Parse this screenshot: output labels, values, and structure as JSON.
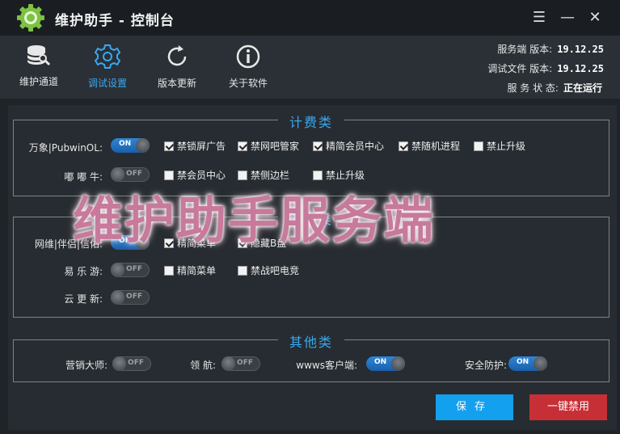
{
  "title": "维护助手 - 控制台",
  "window_controls": {
    "menu": "☰",
    "minimize": "—",
    "close": "✕"
  },
  "toolbar": {
    "items": [
      {
        "label": "维护通道",
        "icon": "database-wrench-icon"
      },
      {
        "label": "调试设置",
        "icon": "gear-icon",
        "active": true
      },
      {
        "label": "版本更新",
        "icon": "refresh-icon"
      },
      {
        "label": "关于软件",
        "icon": "info-icon"
      }
    ]
  },
  "info": {
    "server_version_label": "服务端 版本:",
    "server_version": "19.12.25",
    "debug_version_label": "调试文件 版本:",
    "debug_version": "19.12.25",
    "status_label": "服 务 状 态:",
    "status": "正在运行"
  },
  "groups": {
    "billing": {
      "title": "计费类",
      "rows": [
        {
          "label": "万象|PubwinOL:",
          "toggle": "ON",
          "options": [
            {
              "label": "禁锁屏广告",
              "checked": true
            },
            {
              "label": "禁网吧管家",
              "checked": true
            },
            {
              "label": "精简会员中心",
              "checked": true
            },
            {
              "label": "禁随机进程",
              "checked": true
            },
            {
              "label": "禁止升级",
              "checked": false
            }
          ]
        },
        {
          "label": "嘟 嘟 牛:",
          "toggle": "OFF",
          "options": [
            {
              "label": "禁会员中心",
              "checked": false
            },
            {
              "label": "禁侧边栏",
              "checked": false
            },
            {
              "label": "禁止升级",
              "checked": false
            }
          ]
        }
      ]
    },
    "diskless": {
      "title": "无盘类",
      "rows": [
        {
          "label": "网维|伴侣|信佑:",
          "toggle": "ON",
          "options": [
            {
              "label": "精简菜单",
              "checked": true
            },
            {
              "label": "隐藏B盘",
              "checked": true
            }
          ]
        },
        {
          "label": "易 乐 游:",
          "toggle": "OFF",
          "options": [
            {
              "label": "精简菜单",
              "checked": false
            },
            {
              "label": "禁战吧电竞",
              "checked": false
            }
          ]
        },
        {
          "label": "云 更 新:",
          "toggle": "OFF",
          "options": []
        }
      ]
    },
    "other": {
      "title": "其他类",
      "items": [
        {
          "label": "营销大师:",
          "toggle": "OFF"
        },
        {
          "label": "领 航:",
          "toggle": "OFF"
        },
        {
          "label": "wwws客户端:",
          "toggle": "ON"
        },
        {
          "label": "安全防护:",
          "toggle": "ON"
        }
      ]
    }
  },
  "watermark": "维护助手服务端",
  "buttons": {
    "save": "保存",
    "disable_all": "一键禁用"
  },
  "colors": {
    "accent": "#3aa8f0",
    "save": "#13a0ee",
    "danger": "#c72f36",
    "toggle_on": "#2e86d8"
  }
}
